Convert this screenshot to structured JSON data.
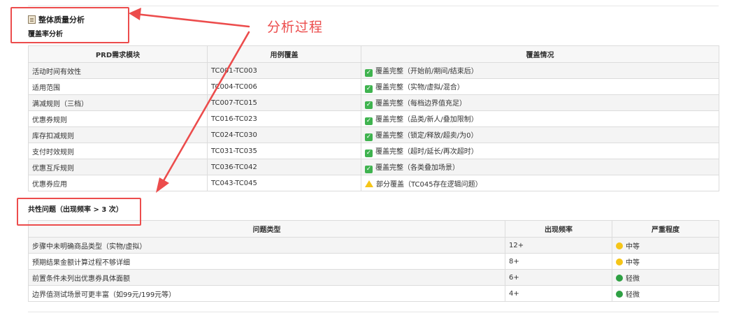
{
  "doc": {
    "section_title": "整体质量分析",
    "coverage_heading": "覆盖率分析",
    "issues_heading": "共性问题（出现频率 > 3 次）"
  },
  "annotation": {
    "label": "分析过程",
    "color": "#ec4c4c"
  },
  "coverage_table": {
    "headers": [
      "PRD需求模块",
      "用例覆盖",
      "覆盖情况"
    ],
    "rows": [
      {
        "module": "活动时间有效性",
        "cases": "TC001-TC003",
        "status_icon": "check-icon",
        "status": "覆盖完整（开始前/期间/结束后）"
      },
      {
        "module": "适用范围",
        "cases": "TC004-TC006",
        "status_icon": "check-icon",
        "status": "覆盖完整（实物/虚拟/混合）"
      },
      {
        "module": "满减规则（三档）",
        "cases": "TC007-TC015",
        "status_icon": "check-icon",
        "status": "覆盖完整（每档边界值充足）"
      },
      {
        "module": "优惠券规则",
        "cases": "TC016-TC023",
        "status_icon": "check-icon",
        "status": "覆盖完整（品类/新人/叠加限制）"
      },
      {
        "module": "库存扣减规则",
        "cases": "TC024-TC030",
        "status_icon": "check-icon",
        "status": "覆盖完整（锁定/释放/超卖/为0）"
      },
      {
        "module": "支付时效规则",
        "cases": "TC031-TC035",
        "status_icon": "check-icon",
        "status": "覆盖完整（超时/延长/再次超时）"
      },
      {
        "module": "优惠互斥规则",
        "cases": "TC036-TC042",
        "status_icon": "check-icon",
        "status": "覆盖完整（各类叠加场景）"
      },
      {
        "module": "优惠券应用",
        "cases": "TC043-TC045",
        "status_icon": "warning-icon",
        "status": "部分覆盖（TC045存在逻辑问题）"
      }
    ]
  },
  "issues_table": {
    "headers": [
      "问题类型",
      "出现频率",
      "严重程度"
    ],
    "rows": [
      {
        "type": "步骤中未明确商品类型（实物/虚拟）",
        "freq": "12+",
        "severity_icon": "yellow-circle-icon",
        "severity_color": "#f5c518",
        "severity": "中等"
      },
      {
        "type": "预期结果金额计算过程不够详细",
        "freq": "8+",
        "severity_icon": "yellow-circle-icon",
        "severity_color": "#f5c518",
        "severity": "中等"
      },
      {
        "type": "前置条件未列出优惠券具体面额",
        "freq": "6+",
        "severity_icon": "green-circle-icon",
        "severity_color": "#2ea043",
        "severity": "轻微"
      },
      {
        "type": "边界值测试场景可更丰富（如99元/199元等）",
        "freq": "4+",
        "severity_icon": "green-circle-icon",
        "severity_color": "#2ea043",
        "severity": "轻微"
      }
    ]
  }
}
